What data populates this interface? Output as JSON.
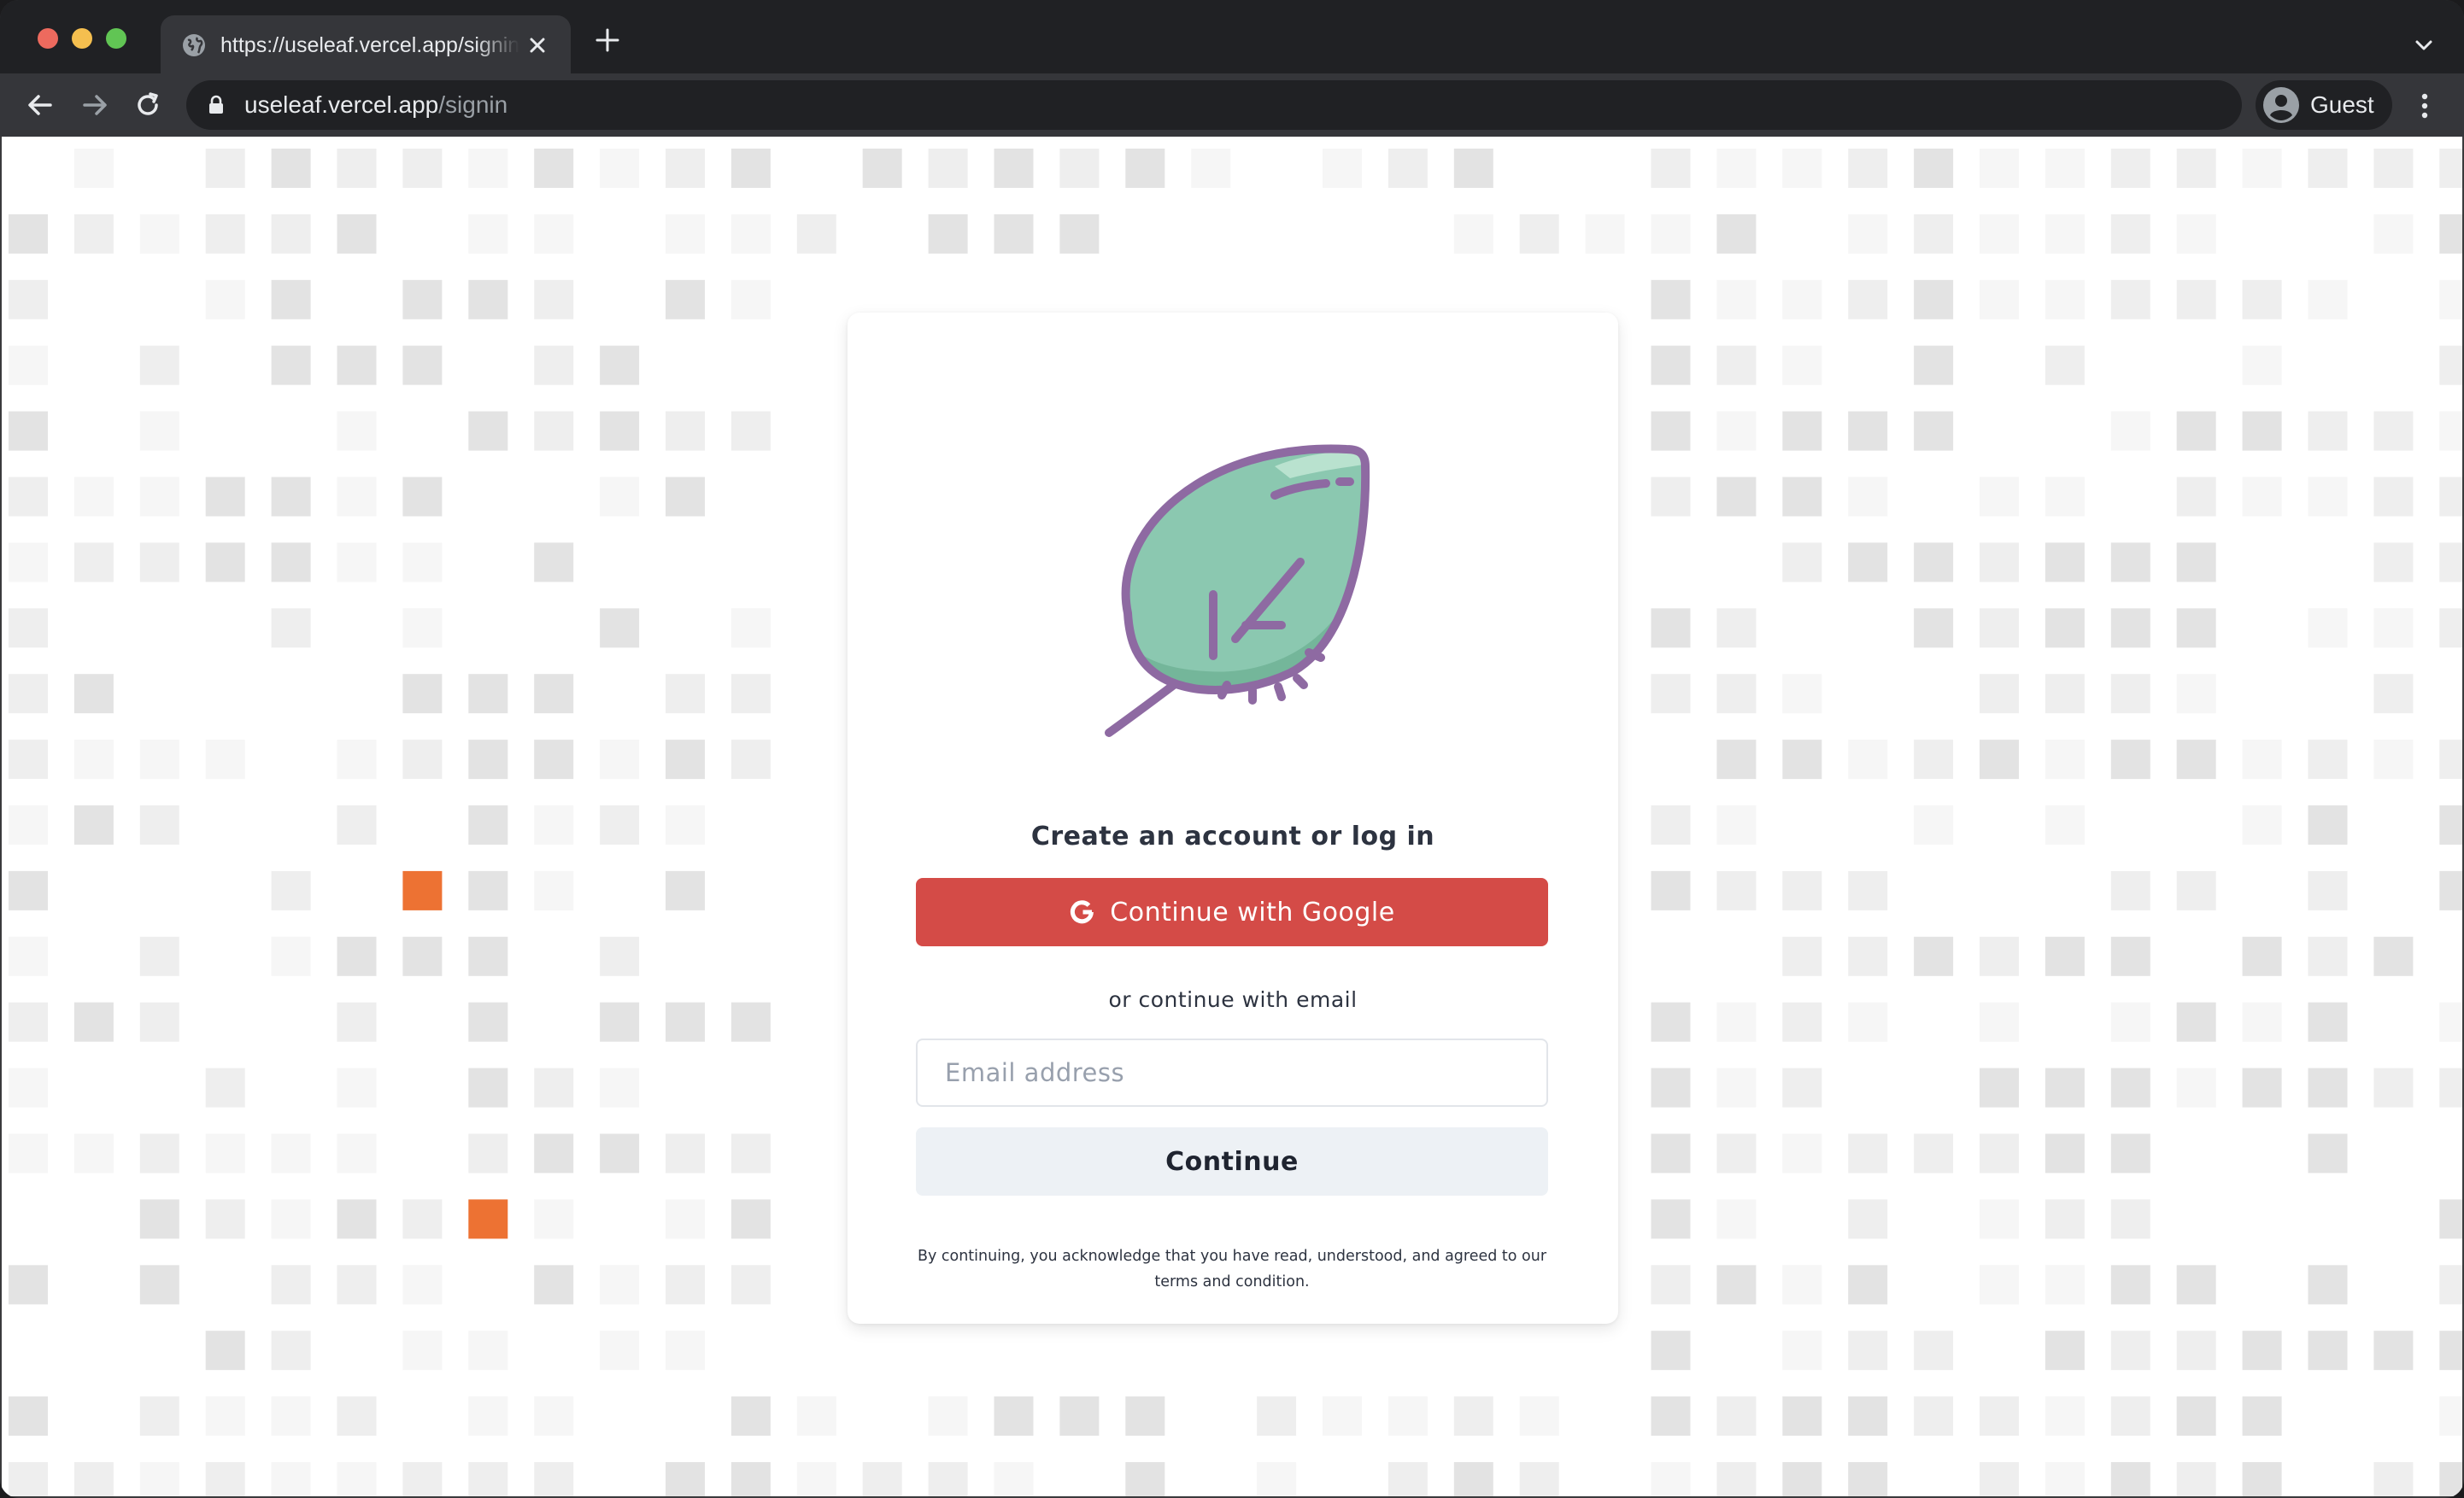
{
  "browser": {
    "tab": {
      "title": "https://useleaf.vercel.app/signin"
    },
    "address_bar": {
      "host": "useleaf.vercel.app",
      "path": "/signin"
    },
    "profile": {
      "name": "Guest"
    },
    "icons": {
      "back": "arrow-left-icon",
      "forward": "arrow-right-icon",
      "reload": "reload-icon",
      "lock": "lock-icon",
      "new_tab": "plus-icon",
      "close_tab": "close-icon",
      "tab_search": "chevron-down-icon",
      "menu": "kebab-menu-icon"
    }
  },
  "signin": {
    "logo": "leaf-icon",
    "heading": "Create an account or log in",
    "google_button": "Continue with Google",
    "divider_text": "or continue with email",
    "email_placeholder": "Email address",
    "continue_button": "Continue",
    "legal_text": "By continuing, you acknowledge that you have read, understood, and agreed to our terms and condition."
  },
  "colors": {
    "google_button": "#d44b47",
    "continue_button_bg": "#edf1f5",
    "leaf_fill": "#8bc8b0",
    "leaf_stroke": "#8e6aa2",
    "accent_tile": "#ed7233",
    "tile_light": "#f6f6f6",
    "tile_mid": "#eeeeee",
    "tile_dark": "#e3e3e3"
  }
}
